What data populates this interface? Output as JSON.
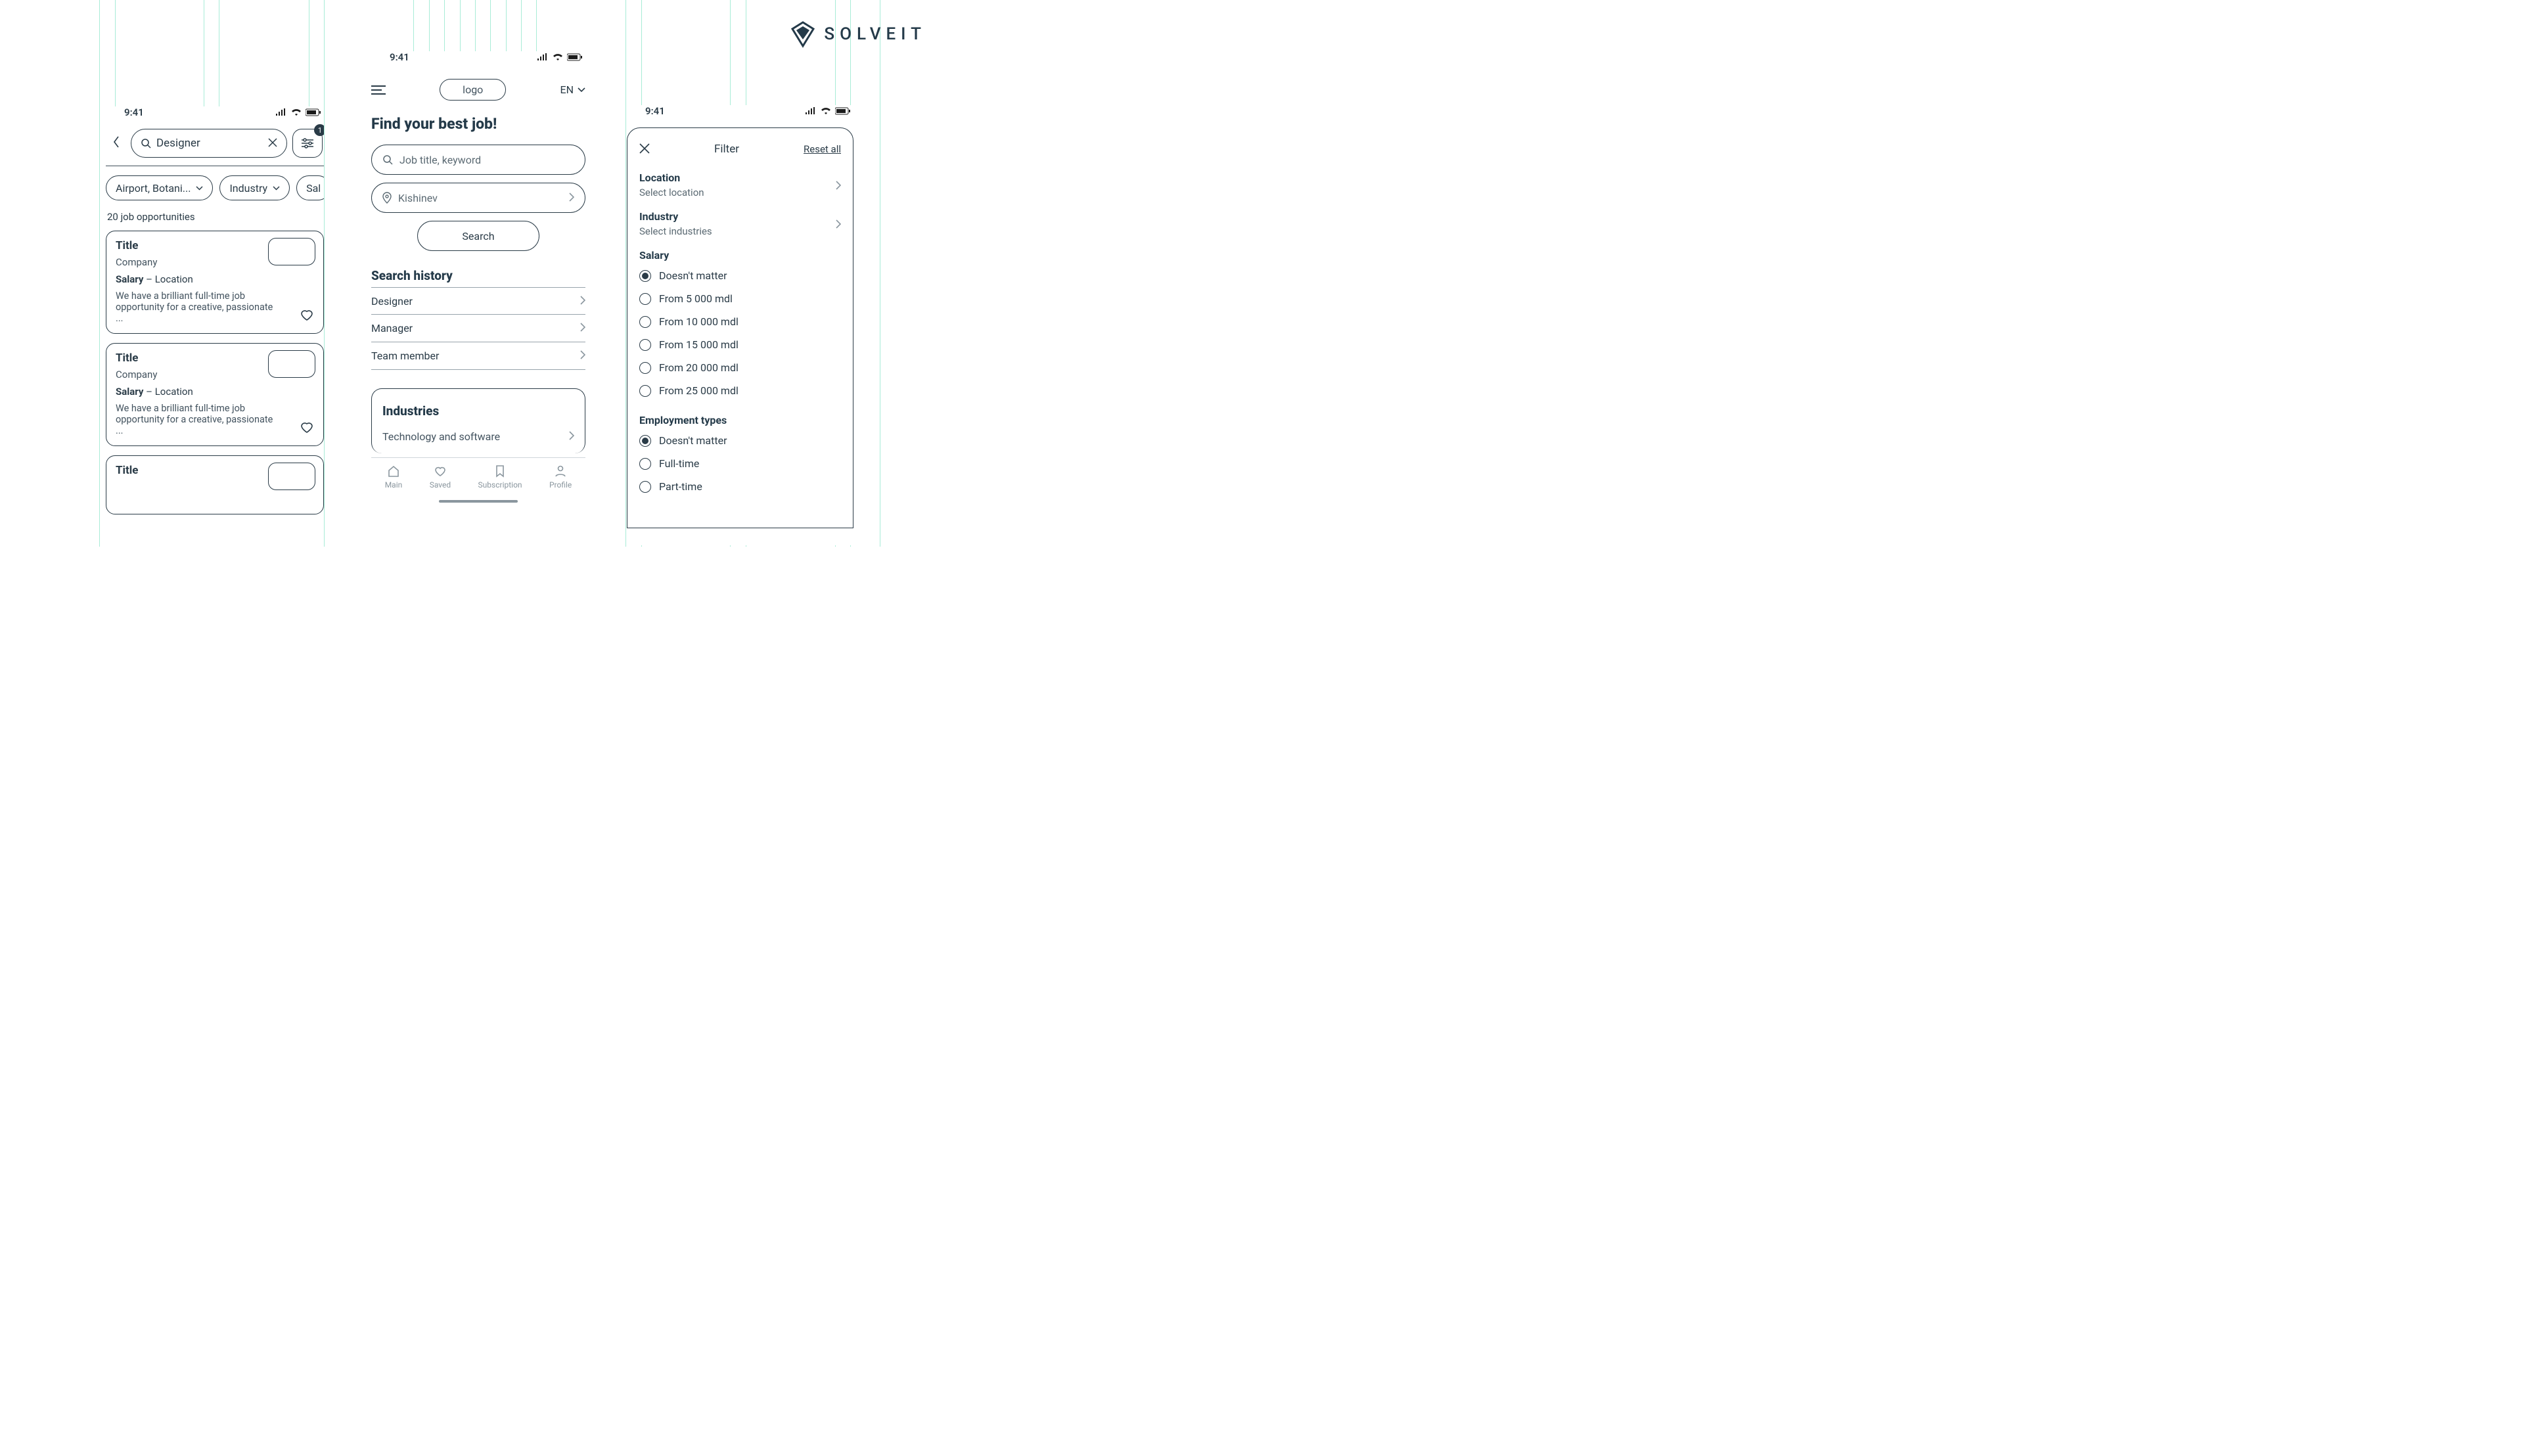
{
  "brand": {
    "name": "SOLVEIT"
  },
  "status": {
    "time": "9:41"
  },
  "s1": {
    "search_value": "Designer",
    "filter_badge": "1",
    "chips": [
      {
        "label": "Airport, Botani...",
        "has_chevron": true
      },
      {
        "label": "Industry",
        "has_chevron": true
      },
      {
        "label": "Sal",
        "has_chevron": false
      }
    ],
    "results_count": "20 job opportunities",
    "cards": [
      {
        "title": "Title",
        "company": "Company",
        "salary_label": "Salary",
        "location_sep": " – ",
        "location": "Location",
        "desc": "We have a brilliant full-time job opportunity for a creative, passionate ..."
      },
      {
        "title": "Title",
        "company": "Company",
        "salary_label": "Salary",
        "location_sep": " – ",
        "location": "Location",
        "desc": "We have a brilliant full-time job opportunity for a creative, passionate ..."
      },
      {
        "title": "Title",
        "company": "",
        "salary_label": "",
        "location_sep": "",
        "location": "",
        "desc": ""
      }
    ]
  },
  "s2": {
    "logo_text": "logo",
    "lang": "EN",
    "hero": "Find your best job!",
    "keyword_placeholder": "Job title, keyword",
    "city": "Kishinev",
    "search_btn": "Search",
    "history_title": "Search history",
    "history": [
      "Designer",
      "Manager",
      "Team member"
    ],
    "industries_title": "Industries",
    "industries": [
      "Technology and software"
    ],
    "nav": {
      "main": "Main",
      "saved": "Saved",
      "subscription": "Subscription",
      "profile": "Profile"
    }
  },
  "s3": {
    "title": "Filter",
    "reset": "Reset all",
    "location_label": "Location",
    "location_value": "Select location",
    "industry_label": "Industry",
    "industry_value": "Select industries",
    "salary_label": "Salary",
    "salary_options": [
      "Doesn't matter",
      "From 5 000 mdl",
      "From 10 000 mdl",
      "From 15 000 mdl",
      "From 20 000 mdl",
      "From 25 000 mdl"
    ],
    "salary_selected_index": 0,
    "employment_label": "Employment types",
    "employment_options": [
      "Doesn't matter",
      "Full-time",
      "Part-time"
    ],
    "employment_selected_index": 0
  }
}
